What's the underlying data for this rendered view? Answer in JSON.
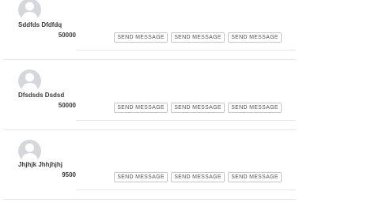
{
  "contacts": [
    {
      "name": "Sddfds Dfdfdq",
      "amount": "50000",
      "buttons": [
        "SEND MESSAGE",
        "SEND MESSAGE",
        "SEND MESSAGE"
      ]
    },
    {
      "name": "Dfsdsds Dsdsd",
      "amount": "50000",
      "buttons": [
        "SEND MESSAGE",
        "SEND MESSAGE",
        "SEND MESSAGE"
      ]
    },
    {
      "name": "Jhjhjk Jhhjhjhj",
      "amount": "9500",
      "buttons": [
        "SEND MESSAGE",
        "SEND MESSAGE",
        "SEND MESSAGE"
      ]
    }
  ],
  "avatar_icon": "user-silhouette-icon",
  "colors": {
    "avatar_bg": "#d4d7db",
    "avatar_fg": "#ffffff",
    "divider": "#e6e6e6",
    "button_border": "#c9c9c9",
    "text": "#3a3a3a"
  }
}
